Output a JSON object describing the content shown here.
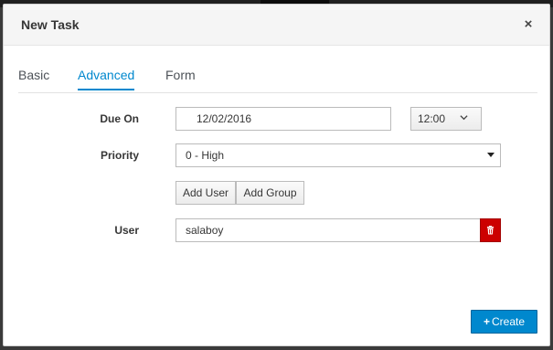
{
  "dialog": {
    "title": "New Task",
    "close_glyph": "×"
  },
  "tabs": [
    {
      "label": "Basic",
      "active": false
    },
    {
      "label": "Advanced",
      "active": true
    },
    {
      "label": "Form",
      "active": false
    }
  ],
  "form": {
    "due_on": {
      "label": "Due On",
      "date": "12/02/2016",
      "time": "12:00"
    },
    "priority": {
      "label": "Priority",
      "selected": "0 - High"
    },
    "add_user_label": "Add User",
    "add_group_label": "Add Group",
    "user": {
      "label": "User",
      "value": "salaboy"
    }
  },
  "footer": {
    "create_label": "Create"
  },
  "icons": {
    "close": "close-icon",
    "chevron": "chevron-down-icon",
    "select_arrow": "caret-down-icon",
    "trash": "trash-icon",
    "plus": "plus-icon"
  },
  "colors": {
    "accent": "#0088ce",
    "danger": "#cc0000"
  }
}
